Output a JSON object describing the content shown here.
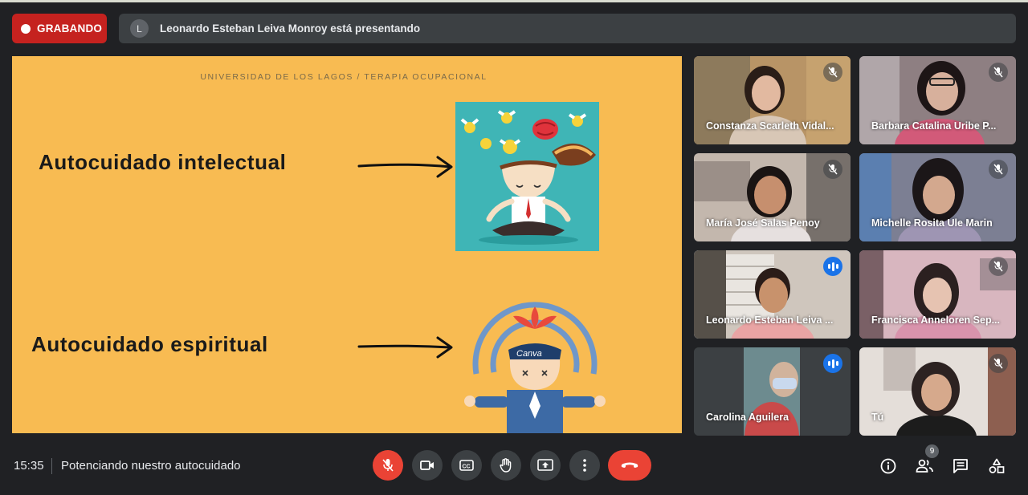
{
  "recording": {
    "label": "GRABANDO"
  },
  "presenting": {
    "avatar_initial": "L",
    "text": "Leonardo Esteban Leiva Monroy está presentando"
  },
  "slide": {
    "header": "UNIVERSIDAD DE LOS LAGOS  /  TERAPIA OCUPACIONAL",
    "concept_1": "Autocuidado intelectual",
    "concept_2": "Autocuidado espiritual",
    "logo_text": "Canva"
  },
  "participants": [
    {
      "name": "Constanza Scarleth Vidal...",
      "status": "muted"
    },
    {
      "name": "Barbara Catalina Uribe P...",
      "status": "muted"
    },
    {
      "name": "María José Salas Penoy",
      "status": "muted"
    },
    {
      "name": "Michelle Rosita Ule Marin",
      "status": "muted"
    },
    {
      "name": "Leonardo Esteban Leiva ...",
      "status": "speaking"
    },
    {
      "name": "Francisca Anneloren Sep...",
      "status": "muted"
    },
    {
      "name": "Carolina Aguilera",
      "status": "speaking"
    },
    {
      "name": "Tú",
      "status": "muted"
    }
  ],
  "bottom_bar": {
    "time": "15:35",
    "meeting_title": "Potenciando nuestro autocuidado",
    "participant_count": "9",
    "controls": [
      "mic-off-icon",
      "camera-icon",
      "captions-icon",
      "raise-hand-icon",
      "present-icon",
      "more-options-icon",
      "hangup-icon"
    ],
    "side_controls": [
      "info-icon",
      "people-icon",
      "chat-icon",
      "activities-icon"
    ]
  },
  "colors": {
    "background": "#202124",
    "recording": "#c5221f",
    "slide_bg": "#f8bb52",
    "accent_blue": "#1a73e8",
    "hangup_red": "#ea4335"
  }
}
